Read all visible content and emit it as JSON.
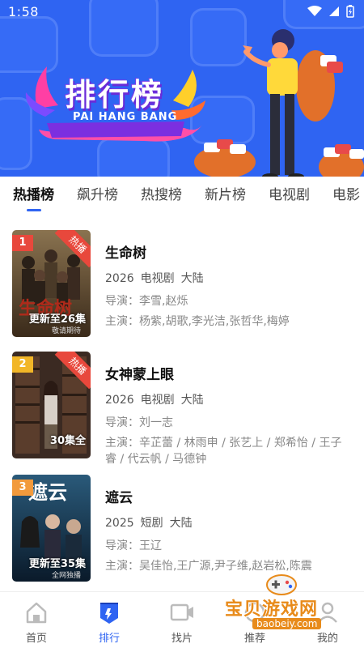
{
  "status_bar": {
    "time": "1:58"
  },
  "banner": {
    "title": "排行榜",
    "subtitle": "PAI HANG BANG"
  },
  "tabs": [
    {
      "label": "热播榜",
      "active": true
    },
    {
      "label": "飙升榜",
      "active": false
    },
    {
      "label": "热搜榜",
      "active": false
    },
    {
      "label": "新片榜",
      "active": false
    },
    {
      "label": "电视剧",
      "active": false
    },
    {
      "label": "电影",
      "active": false
    }
  ],
  "items": [
    {
      "rank": "1",
      "rank_color": "#e8483c",
      "hot_badge": "热播",
      "poster_text": "更新至26集",
      "poster_subtext": "敬请期待",
      "title": "生命树",
      "year": "2026",
      "genre": "电视剧",
      "region": "大陆",
      "director": "导演：李雪,赵烁",
      "cast": "主演：杨紫,胡歌,李光洁,张哲华,梅婷"
    },
    {
      "rank": "2",
      "rank_color": "#f2b627",
      "hot_badge": "热播",
      "poster_text": "30集全",
      "poster_subtext": "",
      "title": "女神蒙上眼",
      "year": "2026",
      "genre": "电视剧",
      "region": "大陆",
      "director": "导演：刘一志",
      "cast": "主演：辛芷蕾 / 林雨申 / 张艺上 / 郑希怡 / 王子睿 / 代云帆 / 马德钟"
    },
    {
      "rank": "3",
      "rank_color": "#f29a3c",
      "hot_badge": "",
      "poster_text": "更新至35集",
      "poster_subtext": "全网独播",
      "title": "遮云",
      "year": "2025",
      "genre": "短剧",
      "region": "大陆",
      "director": "导演：王辽",
      "cast": "主演：吴佳怡,王广源,尹子维,赵岩松,陈震"
    }
  ],
  "bottom_nav": [
    {
      "label": "首页",
      "icon": "home-icon",
      "active": false
    },
    {
      "label": "排行",
      "icon": "ranking-icon",
      "active": true
    },
    {
      "label": "找片",
      "icon": "video-camera-icon",
      "active": false
    },
    {
      "label": "推荐",
      "icon": "recommend-icon",
      "active": false
    },
    {
      "label": "我的",
      "icon": "profile-icon",
      "active": false
    }
  ],
  "watermark": {
    "text": "宝贝游戏网",
    "url": "baobeiy.com"
  },
  "colors": {
    "accent": "#2f64f2",
    "hot": "#e8483c"
  }
}
